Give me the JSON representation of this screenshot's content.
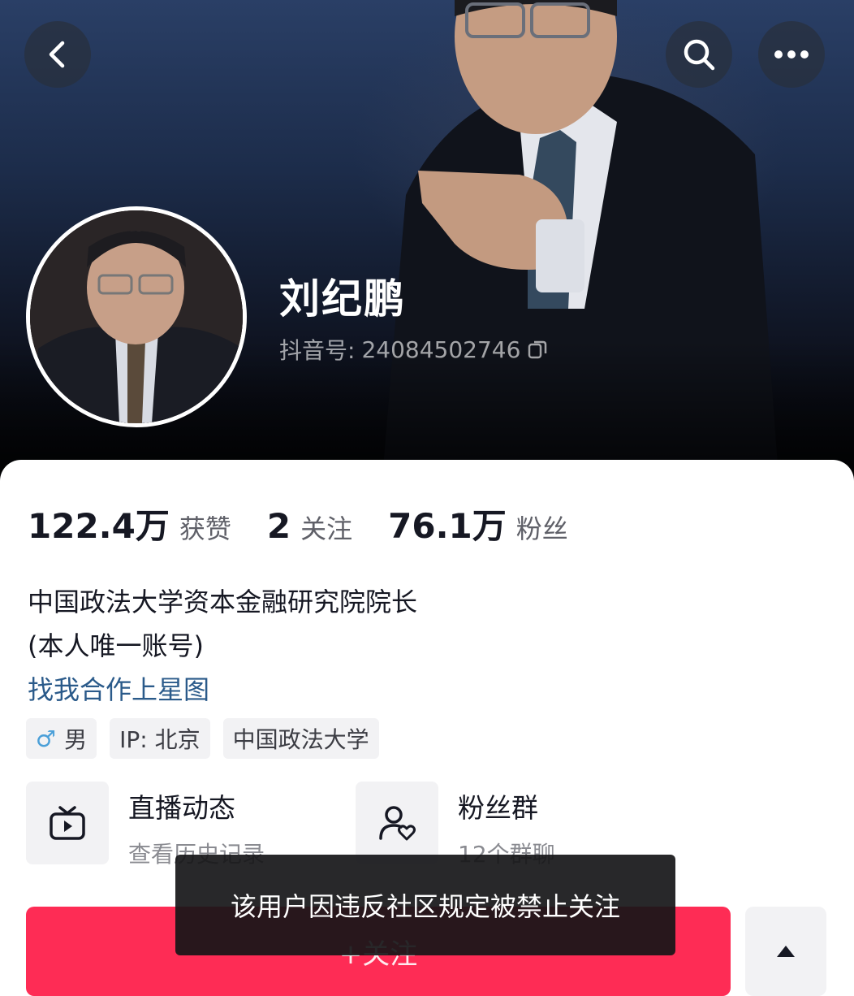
{
  "profile": {
    "name": "刘纪鹏",
    "id_label": "抖音号:",
    "id_value": "24084502746"
  },
  "stats": [
    {
      "value": "122.4万",
      "label": "获赞"
    },
    {
      "value": "2",
      "label": "关注"
    },
    {
      "value": "76.1万",
      "label": "粉丝"
    }
  ],
  "bio": {
    "line1": "中国政法大学资本金融研究院院长",
    "line2": "(本人唯一账号)",
    "link": "找我合作上星图"
  },
  "tags": {
    "gender": "男",
    "ip": "IP: 北京",
    "school": "中国政法大学"
  },
  "cards": {
    "live": {
      "title": "直播动态",
      "subtitle": "查看历史记录"
    },
    "fan_group": {
      "title": "粉丝群",
      "subtitle": "12个群聊"
    }
  },
  "actions": {
    "follow_label": "+关注"
  },
  "toast": {
    "message": "该用户因违反社区规定被禁止关注"
  },
  "icons": {
    "back": "back-icon",
    "search": "search-icon",
    "more": "more-icon",
    "copy": "copy-icon",
    "gender": "male-icon",
    "live": "tv-icon",
    "fan_group": "user-heart-icon",
    "expand": "triangle-up-icon"
  },
  "colors": {
    "accent": "#fe2c55",
    "link": "#2a5a8a",
    "gender": "#4a9fd8"
  }
}
